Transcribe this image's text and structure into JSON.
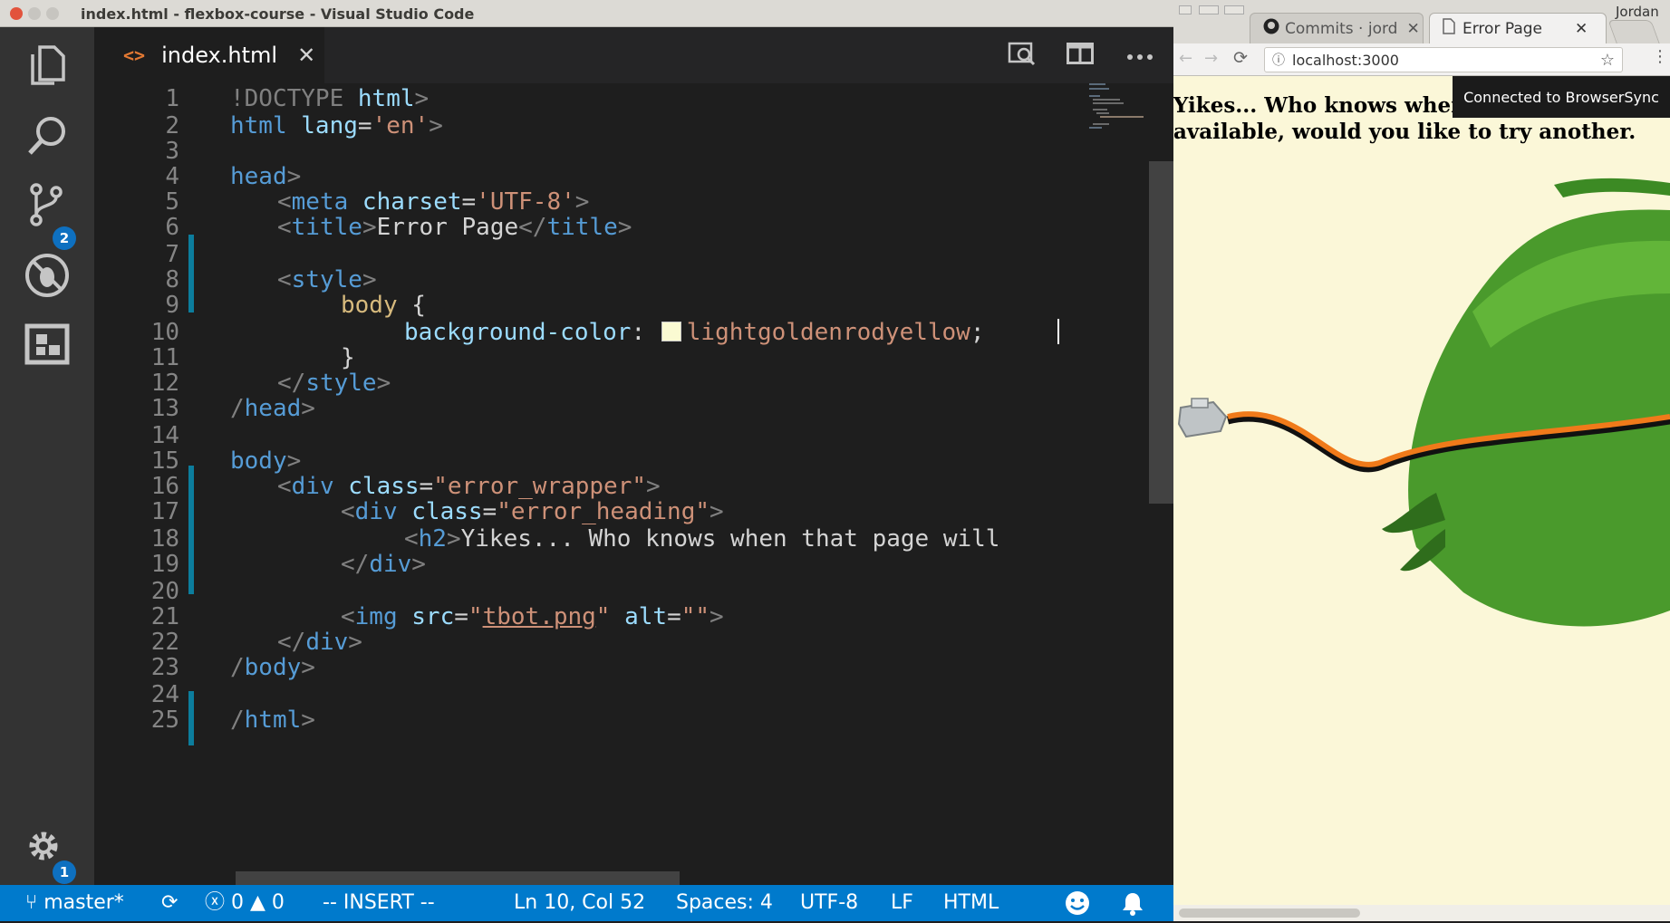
{
  "window": {
    "title": "index.html - flexbox-course - Visual Studio Code"
  },
  "activity_bar": {
    "items": [
      {
        "icon": "files-icon"
      },
      {
        "icon": "search-icon"
      },
      {
        "icon": "source-control-icon",
        "badge": "2"
      },
      {
        "icon": "debug-icon"
      },
      {
        "icon": "extensions-icon"
      }
    ],
    "settings_badge": "1"
  },
  "tab": {
    "icon": "<>",
    "label": "index.html",
    "close": "✕"
  },
  "editor_lines": [
    {
      "n": "1"
    },
    {
      "n": "2"
    },
    {
      "n": "3"
    },
    {
      "n": "4"
    },
    {
      "n": "5"
    },
    {
      "n": "6"
    },
    {
      "n": "7"
    },
    {
      "n": "8"
    },
    {
      "n": "9"
    },
    {
      "n": "10"
    },
    {
      "n": "11"
    },
    {
      "n": "12"
    },
    {
      "n": "13"
    },
    {
      "n": "14"
    },
    {
      "n": "15"
    },
    {
      "n": "16"
    },
    {
      "n": "17"
    },
    {
      "n": "18"
    },
    {
      "n": "19"
    },
    {
      "n": "20"
    },
    {
      "n": "21"
    },
    {
      "n": "22"
    },
    {
      "n": "23"
    },
    {
      "n": "24"
    },
    {
      "n": "25"
    }
  ],
  "code": {
    "l1": {
      "a": "!DOCTYPE",
      "b": " html",
      "c": ">"
    },
    "l2": {
      "a": "html",
      "b": " lang",
      "c": "=",
      "d": "'en'",
      "e": ">"
    },
    "l4": {
      "a": "head",
      "b": ">"
    },
    "l5": {
      "a": "<",
      "b": "meta",
      "c": " charset",
      "d": "=",
      "e": "'UTF-8'",
      "f": ">"
    },
    "l6": {
      "a": "<",
      "b": "title",
      "c": ">",
      "d": "Error Page",
      "e": "</",
      "f": "title",
      "g": ">"
    },
    "l8": {
      "a": "<",
      "b": "style",
      "c": ">"
    },
    "l9": {
      "a": "body",
      "b": " {"
    },
    "l10": {
      "a": "background-color",
      "b": ": ",
      "c": "lightgoldenrodyellow",
      "d": ";"
    },
    "l11": {
      "a": "}"
    },
    "l12": {
      "a": "</",
      "b": "style",
      "c": ">"
    },
    "l13": {
      "a": "/",
      "b": "head",
      "c": ">"
    },
    "l15": {
      "a": "body",
      "b": ">"
    },
    "l16": {
      "a": "<",
      "b": "div",
      "c": " class",
      "d": "=",
      "e": "\"error_wrapper\"",
      "f": ">"
    },
    "l17": {
      "a": "<",
      "b": "div",
      "c": " class",
      "d": "=",
      "e": "\"error_heading\"",
      "f": ">"
    },
    "l18": {
      "a": "<",
      "b": "h2",
      "c": ">",
      "d": "Yikes... Who knows when that page will"
    },
    "l19": {
      "a": "</",
      "b": "div",
      "c": ">"
    },
    "l21": {
      "a": "<",
      "b": "img",
      "c": " src",
      "d": "=",
      "e": "\"",
      "f": "tbot.png",
      "g": "\"",
      "h": " alt",
      "i": "=",
      "j": "\"\"",
      "k": ">"
    },
    "l22": {
      "a": "</",
      "b": "div",
      "c": ">"
    },
    "l23": {
      "a": "/",
      "b": "body",
      "c": ">"
    },
    "l25": {
      "a": "/",
      "b": "html",
      "c": ">"
    }
  },
  "status": {
    "branch": "master*",
    "errors": "0",
    "warnings": "0",
    "mode": "-- INSERT --",
    "position": "Ln 10, Col 52",
    "spaces": "Spaces: 4",
    "encoding": "UTF-8",
    "eol": "LF",
    "language": "HTML"
  },
  "browser": {
    "user": "Jordan",
    "tabs": [
      {
        "label": "Commits · jord"
      },
      {
        "label": "Error Page"
      }
    ],
    "url": "localhost:3000",
    "heading": "Yikes... Who knows when",
    "heading_line2": "available, would you like to try another.",
    "notification": "Connected to BrowserSync"
  },
  "colors": {
    "editor_bg": "#1e1e1e",
    "statusbar": "#007acc",
    "activitybar": "#333333",
    "page_bg": "lightgoldenrodyellow",
    "badge": "#0e70c0"
  }
}
